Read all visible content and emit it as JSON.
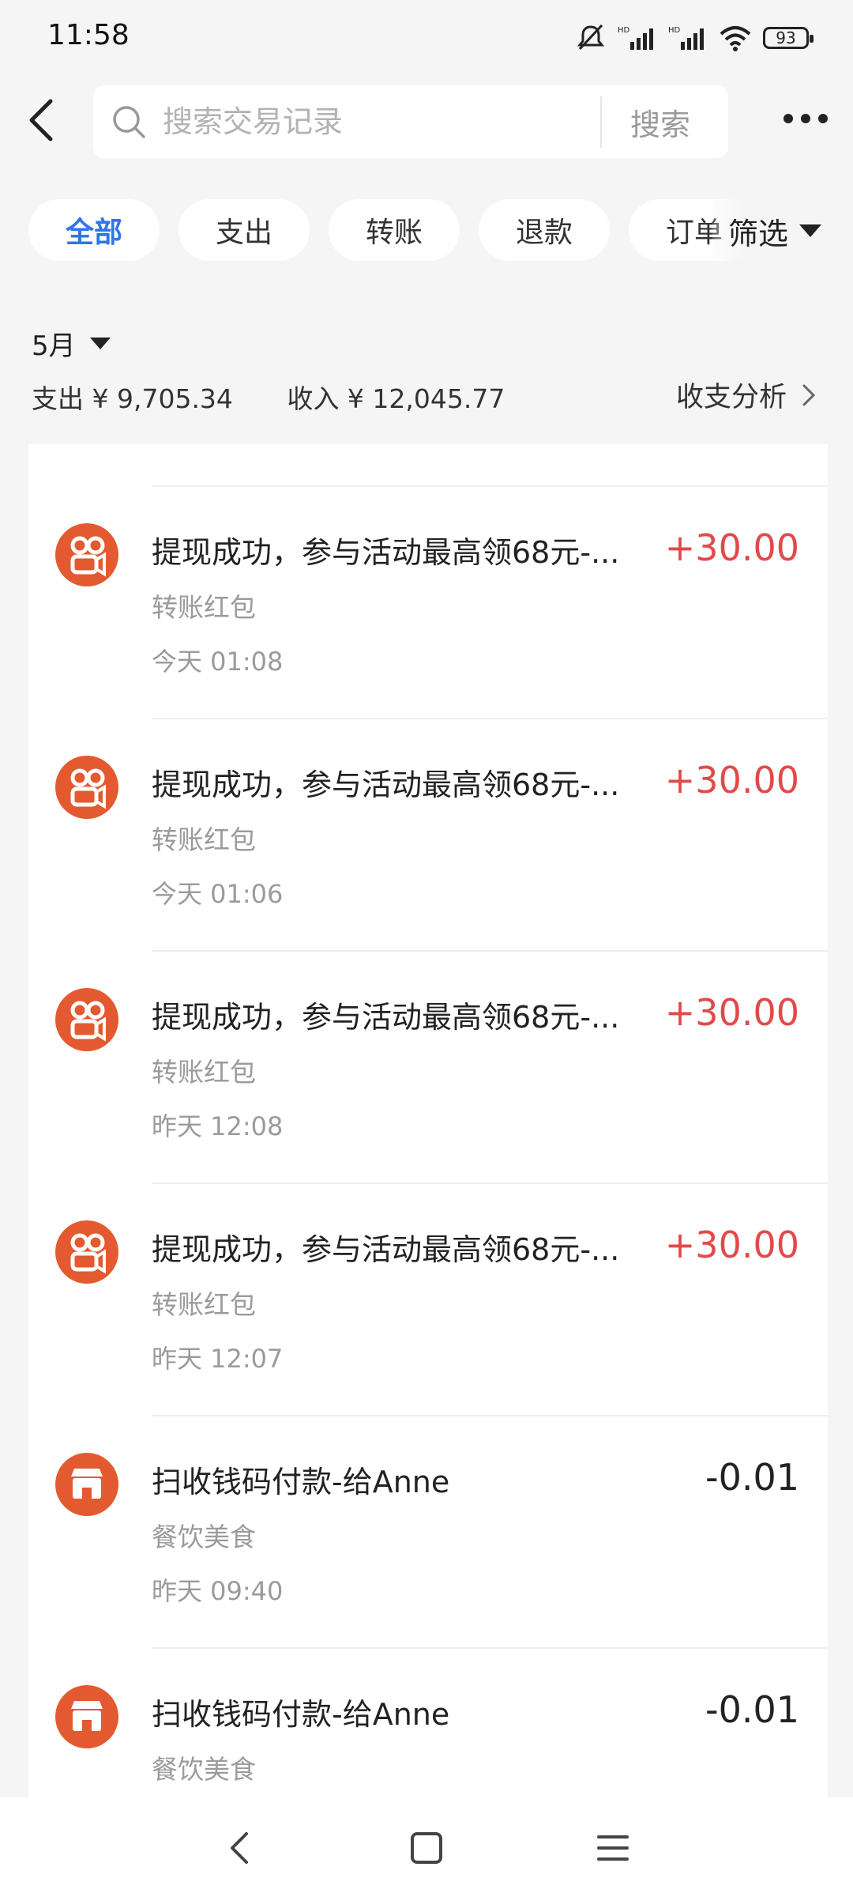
{
  "status": {
    "time": "11:58",
    "battery": "93"
  },
  "search": {
    "placeholder": "搜索交易记录",
    "button": "搜索"
  },
  "chips": [
    "全部",
    "支出",
    "转账",
    "退款",
    "订单"
  ],
  "filter_label": "筛选",
  "summary": {
    "month": "5月",
    "expense": "支出 ¥ 9,705.34",
    "income": "收入 ¥ 12,045.77",
    "analysis": "收支分析"
  },
  "transactions": [
    {
      "title": "提现成功，参与活动最高领68元-...",
      "category": "转账红包",
      "time": "今天 01:08",
      "amount": "+30.00",
      "icon": "kuaishou-icon"
    },
    {
      "title": "提现成功，参与活动最高领68元-...",
      "category": "转账红包",
      "time": "今天 01:06",
      "amount": "+30.00",
      "icon": "kuaishou-icon"
    },
    {
      "title": "提现成功，参与活动最高领68元-...",
      "category": "转账红包",
      "time": "昨天 12:08",
      "amount": "+30.00",
      "icon": "kuaishou-icon"
    },
    {
      "title": "提现成功，参与活动最高领68元-...",
      "category": "转账红包",
      "time": "昨天 12:07",
      "amount": "+30.00",
      "icon": "kuaishou-icon"
    },
    {
      "title": "扫收钱码付款-给Anne",
      "category": "餐饮美食",
      "time": "昨天 09:40",
      "amount": "-0.01",
      "icon": "shop-icon"
    },
    {
      "title": "扫收钱码付款-给Anne",
      "category": "餐饮美食",
      "time": "",
      "amount": "-0.01",
      "icon": "shop-icon"
    }
  ],
  "colors": {
    "accent": "#2f75e6",
    "income": "#e14a4a",
    "icon_bg": "#e35a30"
  }
}
